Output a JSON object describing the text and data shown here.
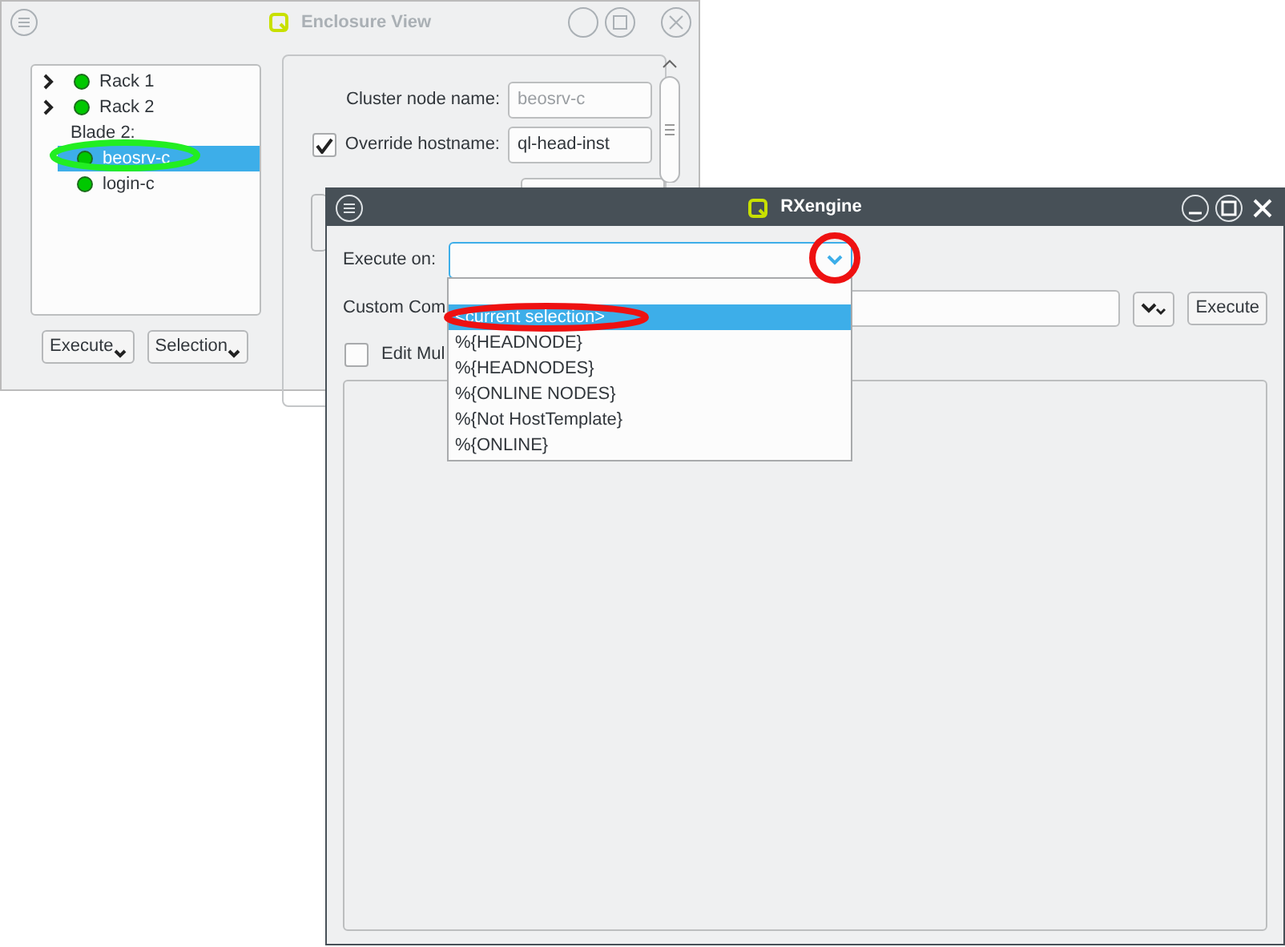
{
  "enclosure_window": {
    "title": "Enclosure View",
    "active": false,
    "tree": [
      {
        "label": "Rack 1",
        "color": "#00c800",
        "expanded": false,
        "selected": false
      },
      {
        "label": "Rack 2",
        "color": "#00c800",
        "expanded": false,
        "selected": false
      },
      {
        "label": "Blade 2:",
        "selected": false,
        "children": [
          {
            "label": "beosrv-c",
            "color": "#00c800",
            "selected": true
          },
          {
            "label": "login-c",
            "color": "#00c800",
            "selected": false
          }
        ]
      }
    ],
    "buttons": [
      "Execute",
      "Selection"
    ],
    "fields": [
      {
        "kind": "text",
        "label": "Cluster node name:",
        "value": "beosrv-c",
        "disabled": true
      },
      {
        "kind": "checkbox",
        "label": "Override hostname:",
        "value": "ql-head-inst",
        "checked": true,
        "disabled": false
      }
    ]
  },
  "rxengine_window": {
    "title": "RXengine",
    "active": true,
    "execute_on": {
      "label": "Execute on:",
      "expanded": true,
      "options": [
        {
          "label": "<current selection>",
          "selected": true
        },
        {
          "label": "%{HEADNODE}",
          "selected": false
        },
        {
          "label": "%{HEADNODES}",
          "selected": false
        },
        {
          "label": "%{ONLINE NODES}",
          "selected": false
        },
        {
          "label": "%{Not HostTemplate}",
          "selected": false
        },
        {
          "label": "%{ONLINE}",
          "selected": false
        }
      ]
    },
    "custom_command": {
      "label": "Custom Com"
    },
    "execute_button": "Execute",
    "edit_multiline": {
      "label": "Edit Mul",
      "checked": false
    }
  }
}
